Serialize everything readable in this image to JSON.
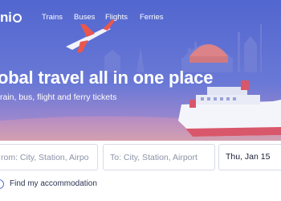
{
  "brand": {
    "name_prefix": "ni",
    "name_suffix": "o"
  },
  "nav": {
    "items": [
      "Trains",
      "Buses",
      "Flights",
      "Ferries"
    ]
  },
  "hero": {
    "headline": "obal travel all in one place",
    "subheadline": "rain, bus, flight and ferry tickets"
  },
  "search": {
    "from_placeholder": "rom: City, Station, Airpo",
    "to_placeholder": "To: City, Station, Airport",
    "date_value": "Thu, Jan 15"
  },
  "accommodation": {
    "label": "Find my accommodation",
    "checked": false
  },
  "colors": {
    "hero_bg": "#5b6fd1",
    "accent": "#5b6fd1",
    "text_dark": "#1a1f36"
  }
}
